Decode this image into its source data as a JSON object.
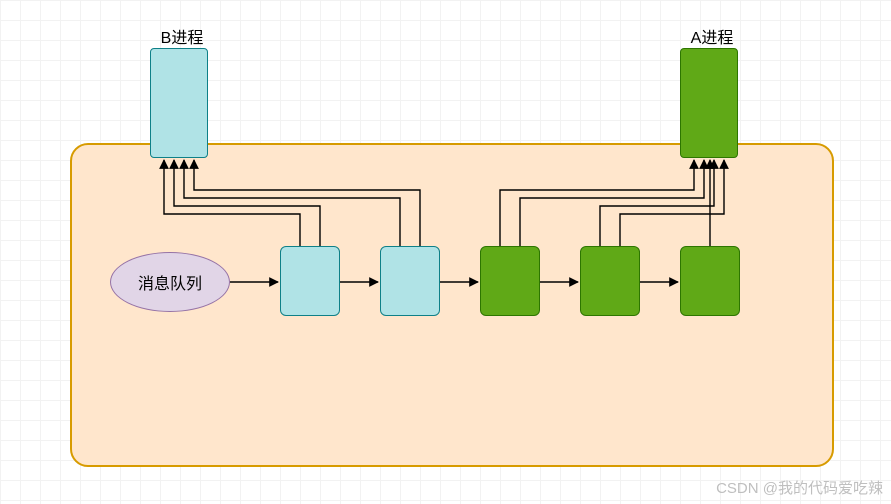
{
  "labels": {
    "b_process": "B进程",
    "a_process": "A进程",
    "queue_label": "消息队列"
  },
  "watermark": "CSDN @我的代码爱吃辣",
  "diagram": {
    "description": "Message queue diagram: an ellipse labeled 消息队列 pushes to a linked list of 5 nodes (2 blue owned by B进程, 3 green owned by A进程). Each node has back-arrows to its owning process box above.",
    "container": {
      "role": "queue-container"
    },
    "processes": [
      {
        "id": "B",
        "label_key": "b_process",
        "color": "blue"
      },
      {
        "id": "A",
        "label_key": "a_process",
        "color": "green"
      }
    ],
    "queue_source": {
      "label_key": "queue_label"
    },
    "nodes": [
      {
        "index": 0,
        "owner": "B",
        "color": "blue"
      },
      {
        "index": 1,
        "owner": "B",
        "color": "blue"
      },
      {
        "index": 2,
        "owner": "A",
        "color": "green"
      },
      {
        "index": 3,
        "owner": "A",
        "color": "green"
      },
      {
        "index": 4,
        "owner": "A",
        "color": "green"
      }
    ]
  }
}
